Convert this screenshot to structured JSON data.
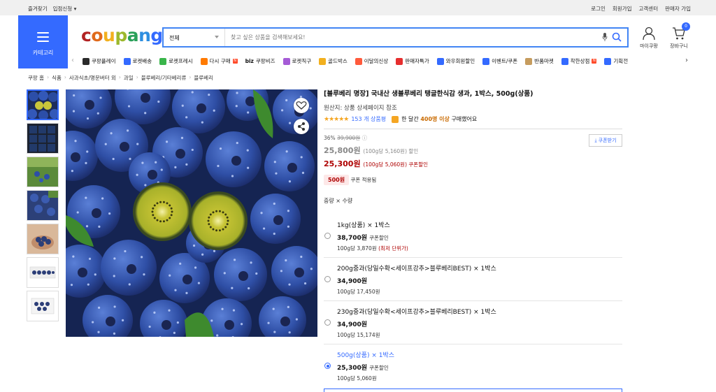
{
  "topbar": {
    "bookmark": "즐겨찾기",
    "seller_apply": "입점신청",
    "login": "로그인",
    "signup": "회원가입",
    "customer_center": "고객센터",
    "seller_signup": "판매자 가입"
  },
  "header": {
    "category_label": "카테고리",
    "logo": [
      "c",
      "o",
      "u",
      "p",
      "a",
      "n",
      "g"
    ],
    "logo_colors": [
      "#b22222",
      "#e06a1b",
      "#f2b01e",
      "#9cb82d",
      "#2aa05a",
      "#2d8ee0",
      "#346aff"
    ],
    "search_category": "전체",
    "search_placeholder": "찾고 싶은 상품을 검색해보세요!",
    "mypage": "마이쿠팡",
    "cart": "장바구니",
    "cart_count": "0"
  },
  "nav": [
    {
      "label": "쿠팡플레이",
      "color": "#2a2a2a"
    },
    {
      "label": "로켓배송",
      "color": "#346aff"
    },
    {
      "label": "로켓프레시",
      "color": "#39b54a"
    },
    {
      "label": "다시 구매",
      "color": "#ff7a00",
      "new": true
    },
    {
      "label": "쿠팡비즈",
      "color": "#111",
      "prefix": "biz"
    },
    {
      "label": "로켓직구",
      "color": "#a55bd6"
    },
    {
      "label": "골드박스",
      "color": "#f2b01e"
    },
    {
      "label": "이달의신상",
      "color": "#ff5a3c"
    },
    {
      "label": "판매자특가",
      "color": "#e62e2e"
    },
    {
      "label": "와우회원할인",
      "color": "#346aff"
    },
    {
      "label": "이벤트/쿠폰",
      "color": "#346aff"
    },
    {
      "label": "반품마켓",
      "color": "#c69c5e"
    },
    {
      "label": "착한상점",
      "color": "#346aff",
      "new": true
    },
    {
      "label": "기획전",
      "color": "#346aff"
    }
  ],
  "breadcrumb": [
    "쿠팡 홈",
    "식품",
    "사과식초/명문버터 외",
    "과일",
    "블루베리/기타베리류",
    "블루베리"
  ],
  "product": {
    "title": "[블루베리 명장] 국내산 생블루베리 탱글한식감 생과, 1박스, 500g(상품)",
    "origin": "원산지: 상품 상세페이지 참조",
    "stars": "★★★★★",
    "reviews": "153 개 상품평",
    "buy_prefix": "한 달간",
    "buy_count": "400명 이상",
    "buy_suffix": "구매했어요",
    "discount_rate": "36%",
    "original_price": "39,900원",
    "sale_price": "25,800원",
    "sale_unit": "(100g당 5,160원) 할인",
    "coupon_price": "25,300원",
    "coupon_unit": "(100g당 5,060원) 쿠폰할인",
    "coupon_button": "쿠폰받기",
    "coupon_chip": "500원",
    "coupon_applied": "쿠폰 적용됨",
    "option_label": "중량 × 수량"
  },
  "options": [
    {
      "name": "1kg(상품) × 1박스",
      "price": "38,700원",
      "price_note": "쿠폰할인",
      "unit": "100g당 3,870원",
      "unit_note": "(최저 단위가)",
      "selected": false
    },
    {
      "name": "200g중과(당일수확<세이프강추>블루베리BEST) × 1박스",
      "price": "34,900원",
      "price_note": "",
      "unit": "100g당 17,450원",
      "unit_note": "",
      "selected": false
    },
    {
      "name": "230g중과(당일수확<세이프강추>블루베리BEST) × 1박스",
      "price": "34,900원",
      "price_note": "",
      "unit": "100g당 15,174원",
      "unit_note": "",
      "selected": false
    },
    {
      "name": "500g(상품) × 1박스",
      "price": "25,300원",
      "price_note": "쿠폰할인",
      "unit": "100g당 5,060원",
      "unit_note": "",
      "selected": true
    }
  ],
  "icons": {
    "wishlist": "heart-icon",
    "share": "share-icon"
  },
  "colors": {
    "accent": "#346aff",
    "coupon": "#ae0000",
    "blueberry": "#2c4ea8"
  }
}
